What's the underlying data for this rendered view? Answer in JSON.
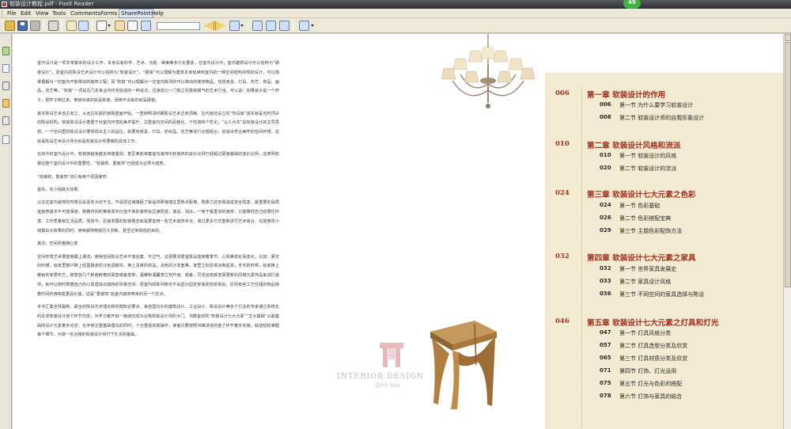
{
  "window": {
    "title": "软装设计教程.pdf - Foxit Reader",
    "notification_badge": "49"
  },
  "menu": {
    "items": [
      "File",
      "Edit",
      "View",
      "Tools",
      "Comments",
      "Forms",
      "SharePoint",
      "Help"
    ]
  },
  "toolbar": {
    "icons": [
      "open-icon",
      "save-icon",
      "scan-icon",
      "print-icon",
      "email-icon",
      "page-setup-icon",
      "page-icon",
      "hand-icon",
      "select-text-icon",
      "find-icon",
      "prev-icon",
      "next-icon",
      "zoom-icon",
      "fit-page-icon",
      "fit-width-icon",
      "rotate-icon",
      "layout-icon"
    ]
  },
  "article": {
    "paragraphs": [
      "室内设计是一项非常繁杂的设计工作，本身具有科学、艺术、功能、审美等多元化要素。在室内设计中，室内建筑设计可以俗称为“硬装设计”，而室内的陈设艺术设计可以俗称为“软装设计”。“硬装”可以理解为建筑本身延续到室内的一种空间结构的规划设计，可以简单理解为一切室内不能移动的装饰工程；而“软装”可以理解为一切室内陈列的可以移动的装饰物品，包括家具、灯具、布艺、饰品、画品、花艺等。“软装”一词是近几年来业内约定俗成的一种说法，迅速成为一门独立而富有朝气的艺术行当。可以说：如果房子是一个杯子，把杯子倒过来，倒掉出来的就是软装，而倒不出来的就是硬装。",
      "其实陈设艺术自古有之，从远古先民的宫殿壁画开始，一直到明清时期陈设艺术达到顶峰。古代宫廷设立的“司设房”其实就是当时顶尖的陈设机构。软装陈设设计着重于对室内环境的美学提升，注重室内空间的风格化、个性独特个性化，“以人为本”是软装设计的主导思想。一个空间里的陈设设计要体现出主人的品位，就要将家具、灯具、纺织品、花艺等进行合理组合，创造出符合美学的空间环境，这就是陈设艺术设计师也就是软装设计师要做的具体工作。",
      "在如今的室内设计中，软装饰越来越多地被重视，甚至某些单套室内装饰中软装饰的造价比例已经超过硬装基础的造价比例，这表明软装在整个室内设计中的重要性，“轻装修、重装饰”已经成为业界大趋势。",
      "“轻装修，重装饰”流行有两个原因使然：",
      "首先，花小钱做大效果。",
      "以往在室内装修的时候总是喜欢大动干戈，不是把这堵墙砸了就是将那堵墙往里移点距离，既费力还容易造成安全隐患，最重要的是居室装修基本不可能保值，随着时间的推移原本价值不菲的装修会迅速贬值，落后、淘汰，一味于看重旧的装修，只能降低自己的居住环境、工作质量和生活品质。而如今，迅速发展的软装概念就是要善用一些艺术装饰手法，通过更多方式重新进行艺术组合，在能够花小钱做出大效果的同时，使得装饰物能历久弥新，甚至达到保值的目的。",
      "其次，空间风格随心变",
      "空间环境艺术要能够跟上潮流，使得空间陈设艺术不落俗套、不过气，这便要求居室陈设能随着季节、心情等变化而变化，比如：夏天的时候，给家里窗户换上轻盈飘逸的冷色调窗帘，换上清爽的床品，浅色的沙发套等，家里立刻显得凉爽起来；冬天的时候，给家换上暖色的家居布艺，随意放几个颜色鲜艳的靠垫或者皮草，温暖和温馨感立刻升级。或者，灵活运用其他易更新的风格元素饰品来进行装饰，就可以随时根据自己的心情营造出独特的风格空间。而室内的陈列物也不会因为固定安装而轻受损失，反而有些工艺性强的物品随着时间的推移能更具价值，这是“重装饰”给室内装饰带来的另一个优点。",
      "本书汇集全球最新、最全的陈设艺术理论和实践知识要点，来自国内外的建筑设计、工业设计、陈设设计等多个行业的专家通过系统化的论述软装设计各个环节内容，为学习者开启一扇通向成为合格软装设计师的大门。书籍首创的“软装设计七大元素”“五大基础”从最基础的设计元素着手论述，在丰常注重基础理论的同时，十分重视实践操作，读者只要按照书籍讲述的各个环节着手实施，就能轻松掌握每个细节，为做一名合格的软装设计师打下扎实的基础。"
    ]
  },
  "watermark": {
    "text": "INTERIOR DESIGN",
    "sub": "@mt-bbs"
  },
  "toc": {
    "chapters": [
      {
        "page": "006",
        "title": "第一章  软装设计的作用",
        "sections": [
          {
            "page": "006",
            "title": "第一节 为什么要学习软装设计"
          },
          {
            "page": "008",
            "title": "第二节 软装设计师的自我形象设计"
          }
        ]
      },
      {
        "page": "010",
        "title": "第二章  软装设计风格和流派",
        "sections": [
          {
            "page": "010",
            "title": "第一节 软装设计的风格"
          },
          {
            "page": "020",
            "title": "第二节 软装设计的流派"
          }
        ]
      },
      {
        "page": "024",
        "title": "第三章  软装设计七大元素之色彩",
        "sections": [
          {
            "page": "024",
            "title": "第一节 色彩基础"
          },
          {
            "page": "026",
            "title": "第二节 色彩搭配宝典"
          },
          {
            "page": "029",
            "title": "第三节 主题色彩配饰方法"
          }
        ]
      },
      {
        "page": "032",
        "title": "第四章  软装设计七大元素之家具",
        "sections": [
          {
            "page": "032",
            "title": "第一节 世界家具发展史"
          },
          {
            "page": "033",
            "title": "第二节 家具设计风格"
          },
          {
            "page": "036",
            "title": "第三节 不同空间的家具选择与陈设"
          }
        ]
      },
      {
        "page": "046",
        "title": "第五章  软装设计七大元素之灯具和灯光",
        "sections": [
          {
            "page": "047",
            "title": "第一节 灯具风格分类"
          },
          {
            "page": "057",
            "title": "第二节 灯具造型分类及欣赏"
          },
          {
            "page": "065",
            "title": "第三节 灯具材质分类及欣赏"
          },
          {
            "page": "071",
            "title": "第四节 灯饰、灯光运用"
          },
          {
            "page": "075",
            "title": "第五节 灯光与色彩的搭配"
          },
          {
            "page": "078",
            "title": "第六节 灯饰与家具的结合"
          }
        ]
      }
    ]
  }
}
